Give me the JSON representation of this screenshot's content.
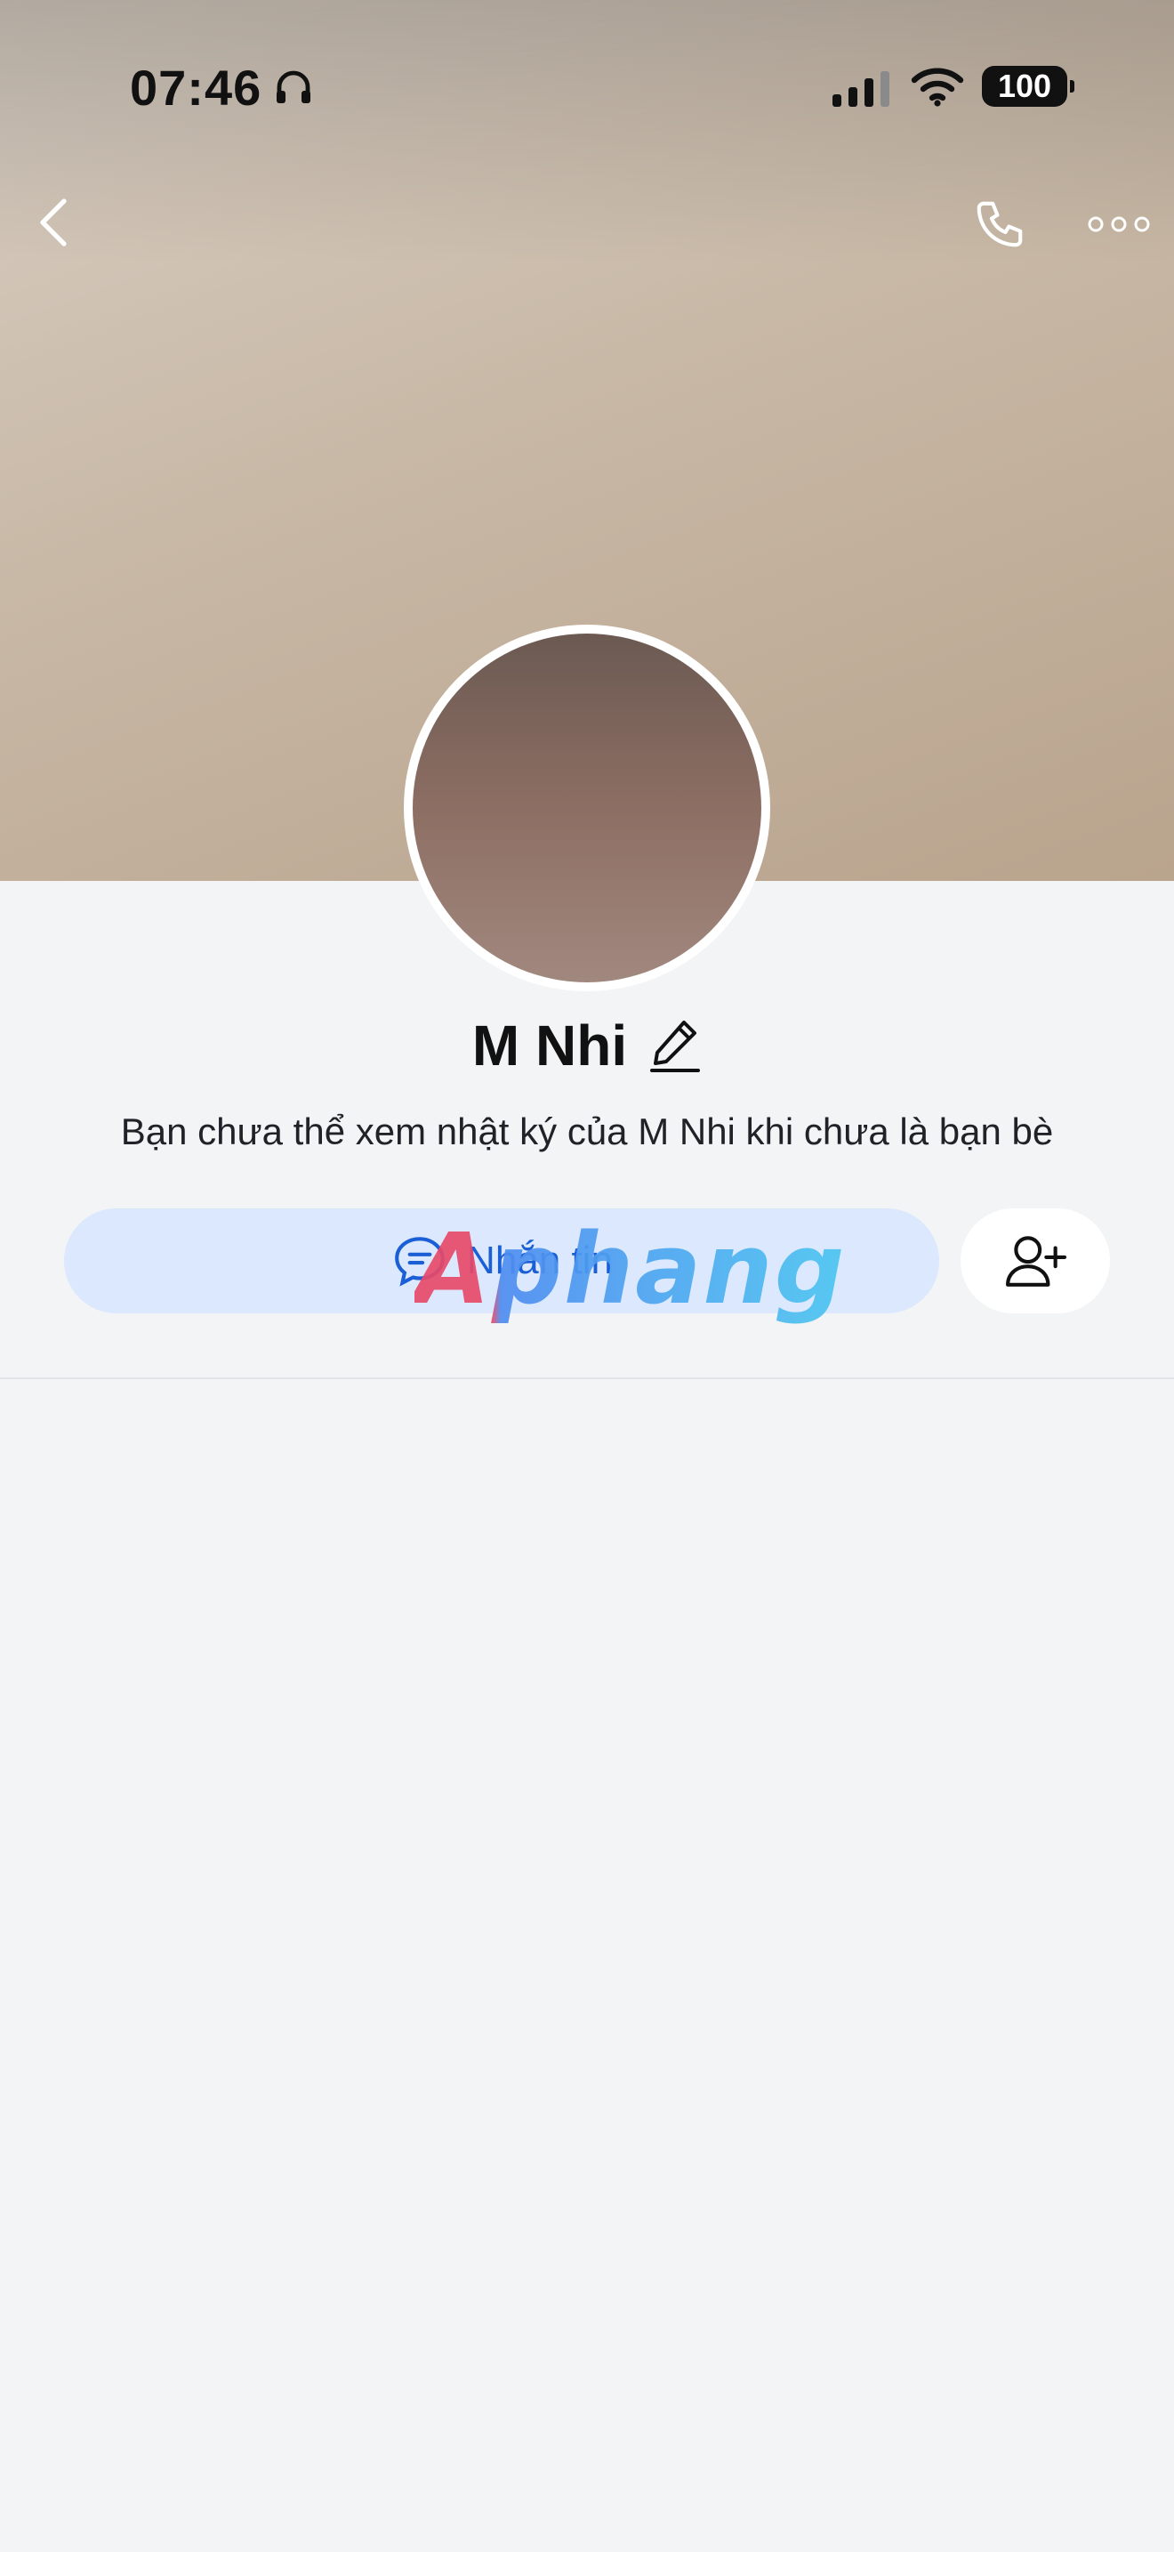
{
  "status_bar": {
    "time": "07:46",
    "battery": "100"
  },
  "profile": {
    "name": "M Nhi",
    "notice": "Bạn chưa thể xem nhật ký của M Nhi khi chưa là bạn bè"
  },
  "actions": {
    "message_label": "Nhắn tin"
  },
  "watermark": "Aphang",
  "colors": {
    "accent": "#1a5fd6",
    "message_bg": "#dbe8fd",
    "page_bg": "#f3f4f6"
  },
  "icons": [
    "back-icon",
    "call-icon",
    "more-icon",
    "edit-icon",
    "message-icon",
    "add-friend-icon",
    "headphone-icon",
    "signal-icon",
    "wifi-icon"
  ]
}
